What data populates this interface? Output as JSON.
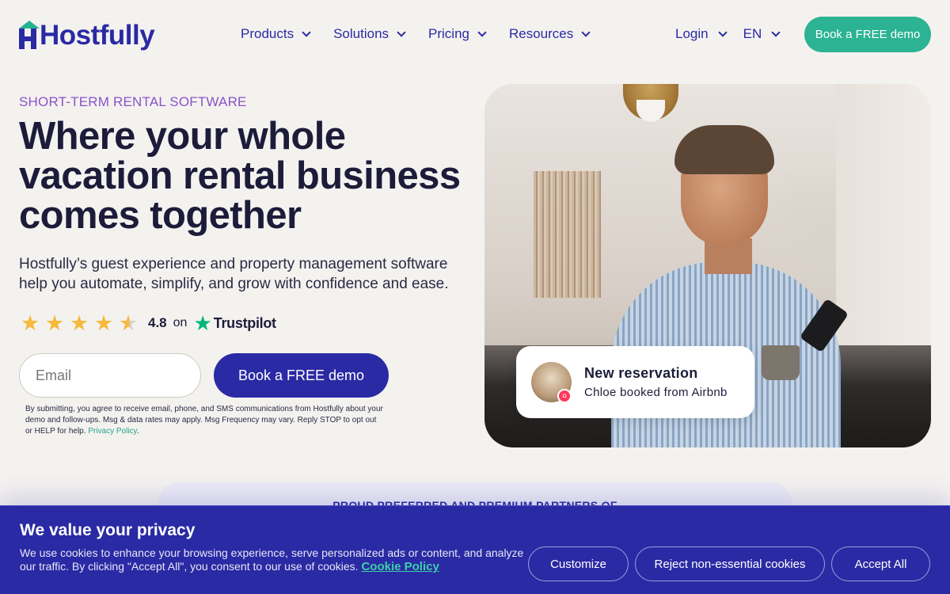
{
  "header": {
    "logo_text": "Hostfully",
    "nav": [
      "Products",
      "Solutions",
      "Pricing",
      "Resources"
    ],
    "login": "Login",
    "language": "EN",
    "cta": "Book a FREE demo"
  },
  "hero": {
    "eyebrow": "SHORT-TERM RENTAL SOFTWARE",
    "title": "Where your whole vacation rental business comes together",
    "subtitle": "Hostfully’s guest experience and property management software help you automate, simplify, and grow with confidence and ease.",
    "rating": {
      "stars": 4.5,
      "score": "4.8",
      "on": "on",
      "brand": "Trustpilot"
    },
    "email_placeholder": "Email",
    "cta": "Book a FREE demo",
    "disclaimer": "By submitting, you agree to receive email, phone, and SMS communications from Hostfully about your demo and follow-ups. Msg & data rates may apply. Msg Frequency may vary. Reply STOP to opt out or HELP for help.",
    "privacy_link": "Privacy Policy"
  },
  "notification": {
    "title": "New reservation",
    "subtitle": "Chloe booked from Airbnb"
  },
  "partners": {
    "title": "PROUD PREFERRED AND PREMIUM PARTNERS OF"
  },
  "cookie": {
    "title": "We value your privacy",
    "text": "We use cookies to enhance your browsing experience, serve personalized ads or content, and analyze our traffic. By clicking \"Accept All\", you consent to our use of cookies.",
    "policy_link": "Cookie Policy",
    "customize": "Customize",
    "reject": "Reject non-essential cookies",
    "accept": "Accept All"
  },
  "colors": {
    "brand_blue": "#2a2aa4",
    "brand_green": "#2bb393",
    "eyebrow_purple": "#8a52c9",
    "star_gold": "#f6b93b",
    "trustpilot_green": "#00b67a"
  }
}
